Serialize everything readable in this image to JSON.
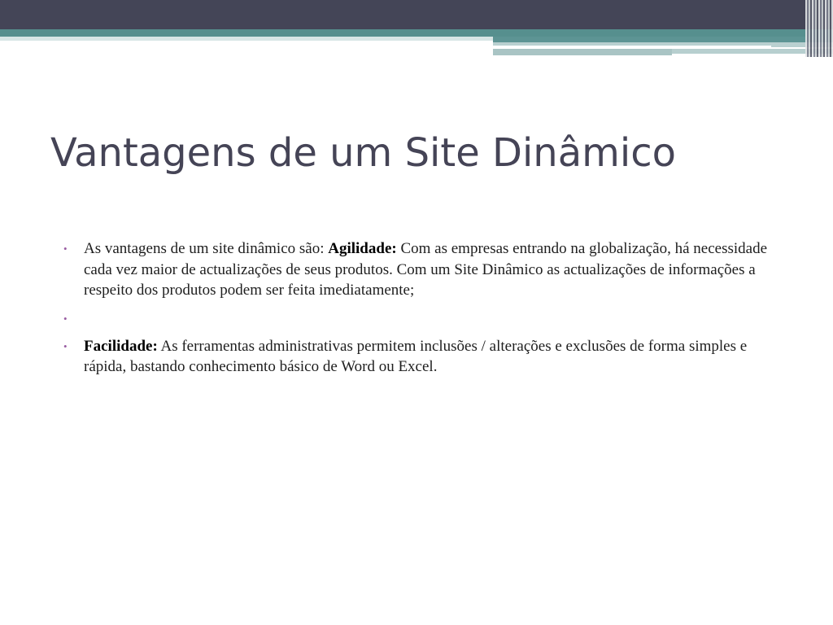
{
  "slide": {
    "title": "Vantagens de um Site Dinâmico",
    "bullets": [
      {
        "prefix": "As vantagens de um site dinâmico são: ",
        "bold": "Agilidade:",
        "text": " Com as empresas entrando na globalização, há necessidade cada vez maior de actualizações de seus produtos. Com um Site Dinâmico as actualizações de informações a respeito dos produtos podem ser feita imediatamente;"
      },
      {
        "prefix": "",
        "bold": "",
        "text": ""
      },
      {
        "prefix": "",
        "bold": "Facilidade:",
        "text": " As ferramentas administrativas permitem inclusões / alterações e exclusões de forma simples e rápida, bastando conhecimento básico de Word ou Excel."
      }
    ],
    "bullet_glyph": "•",
    "colors": {
      "header_dark": "#444557",
      "header_teal": "#568f8e",
      "title": "#454456",
      "bullet": "#9a5ea3"
    }
  }
}
